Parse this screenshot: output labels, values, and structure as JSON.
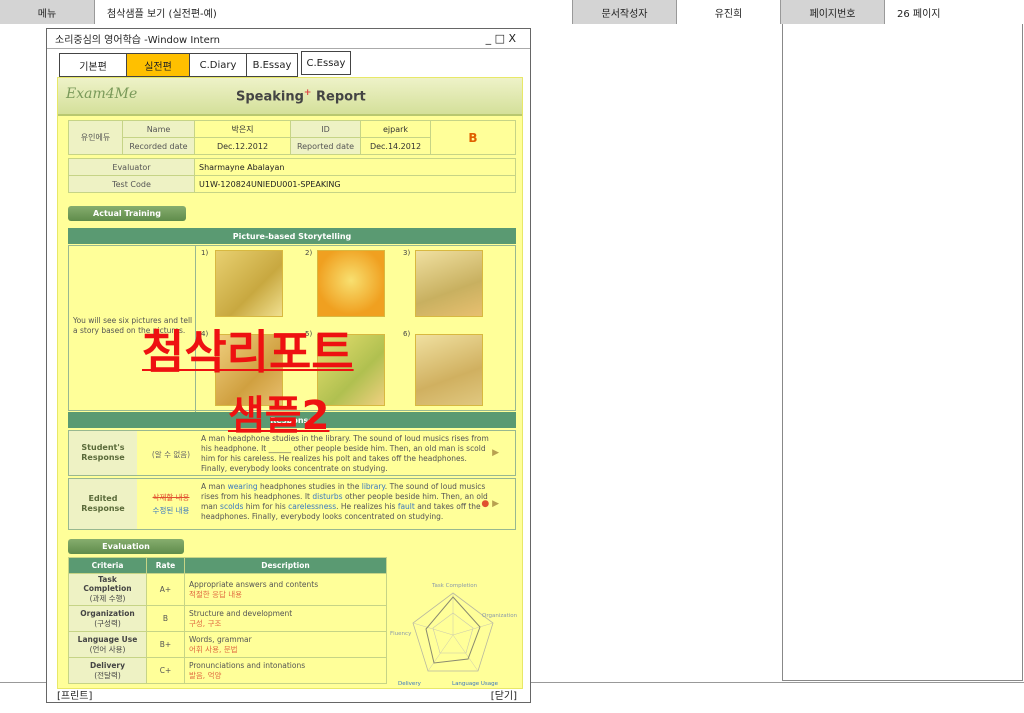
{
  "header": {
    "menu_label": "메뉴",
    "page_title": "첨삭샘플 보기 (실전편-예)",
    "author_label": "문서작성자",
    "author_name": "유진희",
    "page_no_label": "페이지번호",
    "page_no_value": "26 페이지"
  },
  "window": {
    "title": "소리중심의 영어학습 -Window Intern",
    "controls": "_ □ X",
    "tabs": [
      "기본편",
      "실전편",
      "C.Diary",
      "B.Essay",
      "C.Essay"
    ],
    "active_tab": "실전편",
    "print_label": "[프린트]",
    "close_label": "[닫기]"
  },
  "report": {
    "logo": "Exam4Me",
    "title": "Speaking",
    "title_sup": "+",
    "title_tail": "Report",
    "org": "유인에듀",
    "name_label": "Name",
    "name": "박은지",
    "id_label": "ID",
    "id": "ejpark",
    "grade": "B",
    "recorded_label": "Recorded date",
    "recorded": "Dec.12.2012",
    "reported_label": "Reported date",
    "reported": "Dec.14.2012",
    "evaluator_label": "Evaluator",
    "evaluator": "Sharmayne Abalayan",
    "testcode_label": "Test Code",
    "testcode": "U1W-120824UNIEDU001-SPEAKING",
    "actual_training": "Actual Training",
    "story_header": "Picture-based Storytelling",
    "story_instructions": "You will see six pictures and tell a story based on the pictures.",
    "pic_numbers": [
      "1)",
      "2)",
      "3)",
      "4)",
      "5)",
      "6)"
    ],
    "response_header": "Response",
    "student_label": "Student's Response",
    "student_note": "(알 수 없음)",
    "student_text": "A man headphone studies in the library. The sound of loud musics rises from his headphone. It ______ other people beside him. Then, an old man is scold him for his careless. He realizes his polt and takes off the headphones. Finally, everybody looks concentrate on studying.",
    "edited_label": "Edited Response",
    "edited_note_del": "삭제할 내용",
    "edited_note_fix": "수정된 내용",
    "edited_parts": [
      "A man ",
      "wearing",
      " headphones studies in the ",
      "library",
      ". The sound of loud musics rises from his headphones. It ",
      "disturbs",
      " other people beside him. Then, an old man ",
      "scolds",
      " him for his ",
      "carelessness",
      ". He realizes his ",
      "fault",
      " and takes off the headphones. Finally, everybody looks concentrated on studying."
    ],
    "evaluation": "Evaluation",
    "eval_headers": [
      "Criteria",
      "Rate",
      "Description"
    ],
    "eval_rows": [
      {
        "criteria": "Task Completion",
        "criteria_ko": "(과제 수행)",
        "rate": "A+",
        "desc": "Appropriate answers and contents",
        "desc_ko": "적절한 응답 내용"
      },
      {
        "criteria": "Organization",
        "criteria_ko": "(구성력)",
        "rate": "B",
        "desc": "Structure and development",
        "desc_ko": "구성, 구조"
      },
      {
        "criteria": "Language Use",
        "criteria_ko": "(언어 사용)",
        "rate": "B+",
        "desc": "Words, grammar",
        "desc_ko": "어휘 사용, 문법"
      },
      {
        "criteria": "Delivery",
        "criteria_ko": "(전달력)",
        "rate": "C+",
        "desc": "Pronunciations and intonations",
        "desc_ko": "발음, 억양"
      }
    ],
    "radar_labels": [
      "Task Completion",
      "Organization",
      "Language Usage",
      "Delivery",
      "Fluency"
    ]
  },
  "watermark": {
    "line1": "첨삭리포트",
    "line2": "샘플2"
  },
  "colors": {
    "sheet_bg": "#ffff99",
    "active_tab": "#ffc000",
    "watermark": "#ee1111",
    "section_green": "#5a9a72"
  }
}
